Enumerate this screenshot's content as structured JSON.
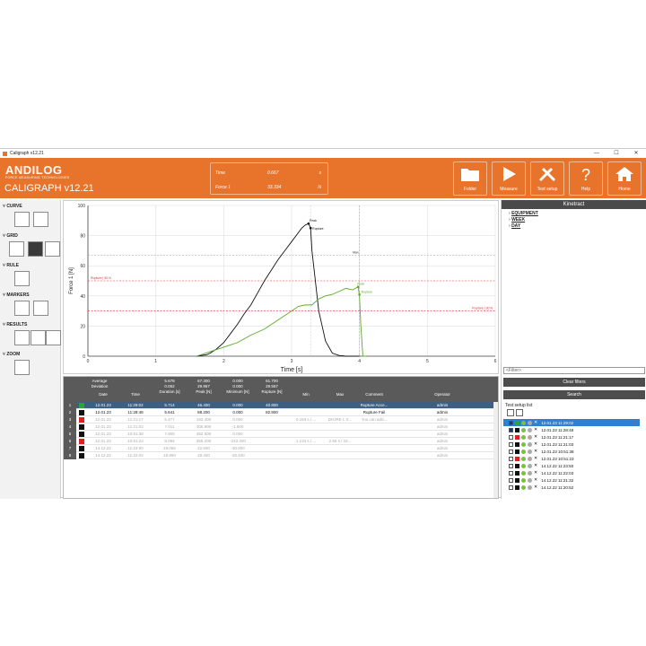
{
  "window": {
    "title": "Caligraph v12.21"
  },
  "window_controls": {
    "minimize": "—",
    "maximize": "☐",
    "close": "✕"
  },
  "header": {
    "logo_text": "ANDILOG",
    "logo_sub": "FORCE MEASURING TECHNOLOGIES",
    "app_title": "CALIGRAPH v12.21",
    "readout": [
      {
        "label": "Time",
        "value": "0.667",
        "unit": "s"
      },
      {
        "label": "Force 1",
        "value": "33.334",
        "unit": "N"
      }
    ],
    "buttons": {
      "folder": "Folder",
      "measure": "Measure",
      "test_setup": "Test setup",
      "help": "Help",
      "home": "Home"
    }
  },
  "left_panel": {
    "sections": {
      "curve": "CURVE",
      "grid": "GRID",
      "rule": "RULE",
      "markers": "MARKERS",
      "results": "RESULTS",
      "zoom": "ZOOM"
    }
  },
  "chart_data": {
    "type": "line",
    "xlabel": "Time [s]",
    "ylabel": "Force 1 [N]",
    "xlim": [
      0,
      6
    ],
    "ylim": [
      0,
      100
    ],
    "xticks": [
      "0",
      "1",
      "2",
      "3",
      "4",
      "5",
      "6"
    ],
    "yticks": [
      "0",
      "20",
      "40",
      "60",
      "80",
      "100"
    ],
    "annotations": {
      "rupture_left": "Rupture | 50 N",
      "rupture_right": "Rupture | 30 N",
      "max": "Max",
      "peak_black": "Peak",
      "rupture_black": "Rupture",
      "peak_green": "Peak",
      "rupture_green": "Rupture"
    },
    "colors": {
      "black": "#111111",
      "green": "#5aaa2a",
      "threshold": "#e03030"
    },
    "series": [
      {
        "color": "black",
        "x": [
          1.6,
          1.75,
          1.8,
          1.9,
          2.0,
          2.1,
          2.2,
          2.3,
          2.4,
          2.5,
          2.6,
          2.7,
          2.8,
          2.9,
          3.0,
          3.1,
          3.15,
          3.2,
          3.25,
          3.28,
          3.3,
          3.35,
          3.4,
          3.5,
          3.6,
          3.7,
          3.8,
          4.0
        ],
        "y": [
          0,
          1,
          2,
          5,
          9,
          15,
          21,
          28,
          34,
          42,
          50,
          57,
          64,
          70,
          76,
          82,
          85,
          87,
          88,
          85,
          70,
          50,
          30,
          10,
          2,
          0.5,
          0,
          0
        ]
      },
      {
        "color": "green",
        "x": [
          1.6,
          1.8,
          2.0,
          2.2,
          2.4,
          2.6,
          2.8,
          3.0,
          3.1,
          3.2,
          3.3,
          3.4,
          3.5,
          3.6,
          3.7,
          3.8,
          3.9,
          3.98,
          4.0,
          4.02,
          4.05,
          4.1
        ],
        "y": [
          0,
          3,
          6,
          9,
          14,
          18,
          24,
          30,
          33,
          34,
          34,
          38,
          40,
          41,
          43,
          45,
          44,
          46,
          40,
          20,
          0,
          0
        ]
      }
    ]
  },
  "table": {
    "summary": {
      "average_label": "Average",
      "deviation_label": "Deviation",
      "average": [
        "5.678",
        "67.300",
        "0.000",
        "61.700"
      ],
      "deviation": [
        "0.052",
        "29.957",
        "0.000",
        "29.557"
      ]
    },
    "headers": [
      "Date",
      "Time",
      "Duration [s]",
      "Peak [N]",
      "Minimum [N]",
      "Rupture [N]",
      "Min",
      "Max",
      "Comment",
      "Operator"
    ],
    "rows": [
      {
        "n": "1",
        "date": "12.01.23",
        "time": "11:29:02",
        "duration": "5.714",
        "peak": "46.400",
        "minimum": "0.000",
        "rupture": "40.800",
        "min": "",
        "max": "",
        "comment": "Rupture Acce...",
        "operator": "admin",
        "color": "#2fa040",
        "state": "sel"
      },
      {
        "n": "2",
        "date": "12.01.23",
        "time": "11:28:48",
        "duration": "5.641",
        "peak": "88.200",
        "minimum": "0.000",
        "rupture": "82.800",
        "min": "",
        "max": "",
        "comment": "Rupture Fail",
        "operator": "admin",
        "color": "#111111",
        "state": ""
      },
      {
        "n": "3",
        "date": "12.01.23",
        "time": "11:21:17",
        "duration": "6.477",
        "peak": "183.400",
        "minimum": "0.000",
        "rupture": "",
        "min": "0.183 s / ...",
        "max": "DHJRE L X...",
        "comment": "You can add...",
        "operator": "admin",
        "color": "#e02020",
        "state": "dim"
      },
      {
        "n": "4",
        "date": "12.01.23",
        "time": "11:21:03",
        "duration": "7.011",
        "peak": "305.900",
        "minimum": "-1.800",
        "rupture": "",
        "min": "",
        "max": "",
        "comment": "",
        "operator": "admin",
        "color": "#111111",
        "state": "dim"
      },
      {
        "n": "5",
        "date": "12.01.23",
        "time": "10:51:38",
        "duration": "7.905",
        "peak": "452.800",
        "minimum": "0.000",
        "rupture": "",
        "min": "",
        "max": "",
        "comment": "",
        "operator": "admin",
        "color": "#111111",
        "state": "dim"
      },
      {
        "n": "6",
        "date": "12.01.23",
        "time": "10:51:23",
        "duration": "8.094",
        "peak": "355.200",
        "minimum": "-243.200",
        "rupture": "",
        "min": "1.134 s / ...",
        "max": "2.56 s / 16...",
        "comment": "",
        "operator": "admin",
        "color": "#e02020",
        "state": "dim"
      },
      {
        "n": "7",
        "date": "14.12.22",
        "time": "11:23:50",
        "duration": "19.066",
        "peak": "22.600",
        "minimum": "-30.000",
        "rupture": "",
        "min": "",
        "max": "",
        "comment": "",
        "operator": "admin",
        "color": "#111111",
        "state": "dim"
      },
      {
        "n": "8",
        "date": "14.12.22",
        "time": "11:22:03",
        "duration": "18.990",
        "peak": "29.400",
        "minimum": "-28.400",
        "rupture": "",
        "min": "",
        "max": "",
        "comment": "",
        "operator": "admin",
        "color": "#111111",
        "state": "dim"
      }
    ]
  },
  "right_panel": {
    "title": "Kinetract",
    "tree": [
      "EQUIPMENT",
      "WEEK",
      "DAY"
    ],
    "filter_placeholder": "<Filter>",
    "clear_filters": "Clear filters",
    "search": "Search",
    "list_title": "Test setup list",
    "items": [
      {
        "label": "12.01.23 11:29:02",
        "color": "#2fa040",
        "checked": true,
        "sel": true
      },
      {
        "label": "12.01.23 11:28:48",
        "color": "#111111",
        "checked": true,
        "sel": false
      },
      {
        "label": "12.01.23 11:21:17",
        "color": "#e02020",
        "checked": false,
        "sel": false
      },
      {
        "label": "12.01.23 11:21:03",
        "color": "#111111",
        "checked": false,
        "sel": false
      },
      {
        "label": "12.01.23 10:51:38",
        "color": "#111111",
        "checked": false,
        "sel": false
      },
      {
        "label": "12.01.23 10:51:23",
        "color": "#e02020",
        "checked": false,
        "sel": false
      },
      {
        "label": "14.12.22 11:23:50",
        "color": "#111111",
        "checked": false,
        "sel": false
      },
      {
        "label": "14.12.22 11:22:03",
        "color": "#111111",
        "checked": false,
        "sel": false
      },
      {
        "label": "14.12.22 11:21:32",
        "color": "#111111",
        "checked": false,
        "sel": false
      },
      {
        "label": "14.12.22 11:20:52",
        "color": "#111111",
        "checked": false,
        "sel": false
      }
    ]
  }
}
